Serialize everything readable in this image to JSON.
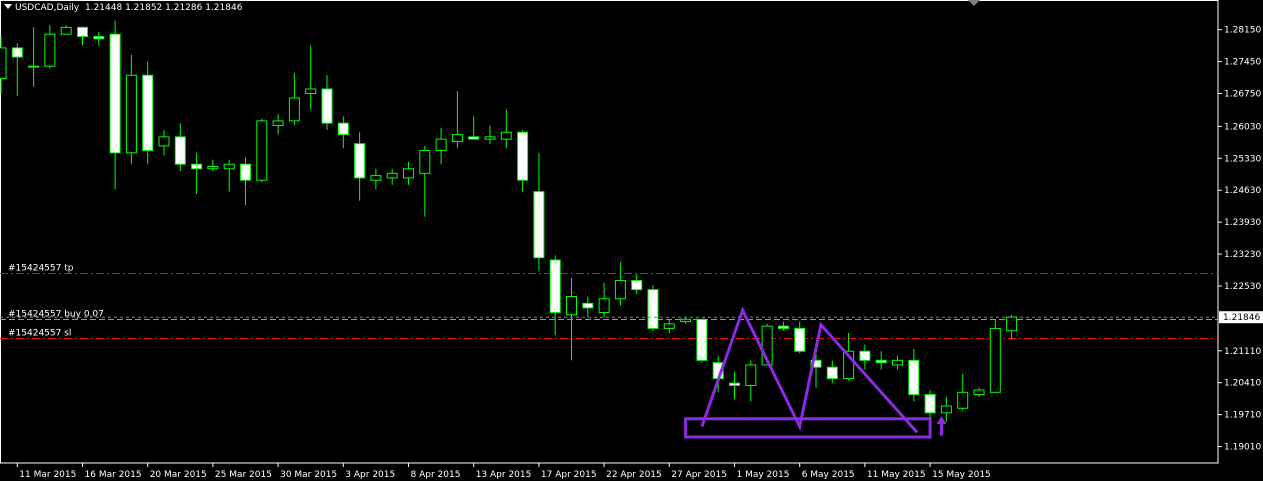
{
  "header": {
    "symbol": "USDCAD,Daily",
    "ohlc": "1.21448 1.21852 1.21286 1.21846"
  },
  "colors": {
    "background": "#000000",
    "frame": "#ffffff",
    "bull_body": "#000000",
    "bear_body": "#ffffff",
    "wick": "#00ff00",
    "order_line_sl_tp": "#ff0000",
    "order_line_buy": "#00ff00",
    "pattern_line": "#8a2be2"
  },
  "chart_data": {
    "type": "candlestick",
    "ylim": [
      1.1865,
      1.288
    ],
    "y_ticks": [
      "1.28150",
      "1.27450",
      "1.26750",
      "1.26030",
      "1.25330",
      "1.24630",
      "1.23930",
      "1.23230",
      "1.22530",
      "1.21110",
      "1.20410",
      "1.19710",
      "1.19010"
    ],
    "x_labels": [
      {
        "label": "11 Mar 2015",
        "bar": 1
      },
      {
        "label": "16 Mar 2015",
        "bar": 5
      },
      {
        "label": "20 Mar 2015",
        "bar": 9
      },
      {
        "label": "25 Mar 2015",
        "bar": 13
      },
      {
        "label": "30 Mar 2015",
        "bar": 17
      },
      {
        "label": "3 Apr 2015",
        "bar": 21
      },
      {
        "label": "8 Apr 2015",
        "bar": 25
      },
      {
        "label": "13 Apr 2015",
        "bar": 29
      },
      {
        "label": "17 Apr 2015",
        "bar": 33
      },
      {
        "label": "22 Apr 2015",
        "bar": 37
      },
      {
        "label": "27 Apr 2015",
        "bar": 41
      },
      {
        "label": "1 May 2015",
        "bar": 45
      },
      {
        "label": "6 May 2015",
        "bar": 49
      },
      {
        "label": "11 May 2015",
        "bar": 53
      },
      {
        "label": "15 May 2015",
        "bar": 57
      }
    ],
    "candles": [
      {
        "o": 1.2708,
        "h": 1.28,
        "l": 1.2675,
        "c": 1.2775
      },
      {
        "o": 1.2775,
        "h": 1.2785,
        "l": 1.267,
        "c": 1.2755
      },
      {
        "o": 1.2735,
        "h": 1.282,
        "l": 1.269,
        "c": 1.2735
      },
      {
        "o": 1.2735,
        "h": 1.2825,
        "l": 1.273,
        "c": 1.2805
      },
      {
        "o": 1.2805,
        "h": 1.2825,
        "l": 1.2805,
        "c": 1.282
      },
      {
        "o": 1.282,
        "h": 1.2822,
        "l": 1.278,
        "c": 1.28
      },
      {
        "o": 1.28,
        "h": 1.281,
        "l": 1.278,
        "c": 1.2795
      },
      {
        "o": 1.2805,
        "h": 1.2835,
        "l": 1.2465,
        "c": 1.2545
      },
      {
        "o": 1.2545,
        "h": 1.276,
        "l": 1.252,
        "c": 1.2715
      },
      {
        "o": 1.2715,
        "h": 1.2745,
        "l": 1.252,
        "c": 1.255
      },
      {
        "o": 1.256,
        "h": 1.2595,
        "l": 1.254,
        "c": 1.258
      },
      {
        "o": 1.258,
        "h": 1.261,
        "l": 1.2505,
        "c": 1.252
      },
      {
        "o": 1.252,
        "h": 1.2545,
        "l": 1.2455,
        "c": 1.251
      },
      {
        "o": 1.251,
        "h": 1.253,
        "l": 1.2505,
        "c": 1.2515
      },
      {
        "o": 1.251,
        "h": 1.253,
        "l": 1.246,
        "c": 1.252
      },
      {
        "o": 1.252,
        "h": 1.2535,
        "l": 1.243,
        "c": 1.2485
      },
      {
        "o": 1.2485,
        "h": 1.262,
        "l": 1.248,
        "c": 1.2615
      },
      {
        "o": 1.2605,
        "h": 1.263,
        "l": 1.2585,
        "c": 1.2615
      },
      {
        "o": 1.2615,
        "h": 1.272,
        "l": 1.2605,
        "c": 1.2665
      },
      {
        "o": 1.2675,
        "h": 1.278,
        "l": 1.264,
        "c": 1.2685
      },
      {
        "o": 1.2685,
        "h": 1.2715,
        "l": 1.2595,
        "c": 1.261
      },
      {
        "o": 1.261,
        "h": 1.2625,
        "l": 1.2555,
        "c": 1.2585
      },
      {
        "o": 1.2565,
        "h": 1.259,
        "l": 1.244,
        "c": 1.249
      },
      {
        "o": 1.2485,
        "h": 1.251,
        "l": 1.2465,
        "c": 1.2495
      },
      {
        "o": 1.249,
        "h": 1.251,
        "l": 1.2475,
        "c": 1.25
      },
      {
        "o": 1.249,
        "h": 1.2525,
        "l": 1.2475,
        "c": 1.251
      },
      {
        "o": 1.25,
        "h": 1.256,
        "l": 1.2405,
        "c": 1.255
      },
      {
        "o": 1.255,
        "h": 1.26,
        "l": 1.252,
        "c": 1.2575
      },
      {
        "o": 1.257,
        "h": 1.268,
        "l": 1.2555,
        "c": 1.2585
      },
      {
        "o": 1.258,
        "h": 1.2625,
        "l": 1.2575,
        "c": 1.2575
      },
      {
        "o": 1.2575,
        "h": 1.2605,
        "l": 1.2565,
        "c": 1.258
      },
      {
        "o": 1.2575,
        "h": 1.264,
        "l": 1.2555,
        "c": 1.259
      },
      {
        "o": 1.259,
        "h": 1.2595,
        "l": 1.246,
        "c": 1.2485
      },
      {
        "o": 1.246,
        "h": 1.2545,
        "l": 1.2285,
        "c": 1.2315
      },
      {
        "o": 1.231,
        "h": 1.232,
        "l": 1.2145,
        "c": 1.2195
      },
      {
        "o": 1.219,
        "h": 1.227,
        "l": 1.209,
        "c": 1.223
      },
      {
        "o": 1.2215,
        "h": 1.223,
        "l": 1.2185,
        "c": 1.2205
      },
      {
        "o": 1.2195,
        "h": 1.226,
        "l": 1.2185,
        "c": 1.2225
      },
      {
        "o": 1.2225,
        "h": 1.2305,
        "l": 1.221,
        "c": 1.2265
      },
      {
        "o": 1.2265,
        "h": 1.228,
        "l": 1.2235,
        "c": 1.2245
      },
      {
        "o": 1.2245,
        "h": 1.2255,
        "l": 1.2155,
        "c": 1.216
      },
      {
        "o": 1.216,
        "h": 1.218,
        "l": 1.215,
        "c": 1.217
      },
      {
        "o": 1.2175,
        "h": 1.2185,
        "l": 1.217,
        "c": 1.218
      },
      {
        "o": 1.218,
        "h": 1.218,
        "l": 1.2085,
        "c": 1.209
      },
      {
        "o": 1.2085,
        "h": 1.21,
        "l": 1.202,
        "c": 1.205
      },
      {
        "o": 1.204,
        "h": 1.2065,
        "l": 1.2005,
        "c": 1.2035
      },
      {
        "o": 1.2035,
        "h": 1.209,
        "l": 1.2,
        "c": 1.208
      },
      {
        "o": 1.208,
        "h": 1.217,
        "l": 1.208,
        "c": 1.2165
      },
      {
        "o": 1.2165,
        "h": 1.2175,
        "l": 1.2155,
        "c": 1.216
      },
      {
        "o": 1.216,
        "h": 1.2175,
        "l": 1.2105,
        "c": 1.211
      },
      {
        "o": 1.209,
        "h": 1.2105,
        "l": 1.203,
        "c": 1.2075
      },
      {
        "o": 1.2075,
        "h": 1.209,
        "l": 1.204,
        "c": 1.205
      },
      {
        "o": 1.205,
        "h": 1.215,
        "l": 1.2045,
        "c": 1.211
      },
      {
        "o": 1.211,
        "h": 1.2125,
        "l": 1.207,
        "c": 1.209
      },
      {
        "o": 1.209,
        "h": 1.211,
        "l": 1.207,
        "c": 1.2085
      },
      {
        "o": 1.208,
        "h": 1.21,
        "l": 1.207,
        "c": 1.209
      },
      {
        "o": 1.209,
        "h": 1.2115,
        "l": 1.2,
        "c": 1.2015
      },
      {
        "o": 1.2015,
        "h": 1.2025,
        "l": 1.1945,
        "c": 1.1975
      },
      {
        "o": 1.1975,
        "h": 1.201,
        "l": 1.1955,
        "c": 1.199
      },
      {
        "o": 1.1985,
        "h": 1.206,
        "l": 1.198,
        "c": 1.202
      },
      {
        "o": 1.2015,
        "h": 1.203,
        "l": 1.201,
        "c": 1.2025
      },
      {
        "o": 1.202,
        "h": 1.218,
        "l": 1.202,
        "c": 1.216
      },
      {
        "o": 1.2155,
        "h": 1.219,
        "l": 1.2135,
        "c": 1.2185
      }
    ],
    "current_price": "1.21846",
    "order_lines": [
      {
        "label": "#15424557 tp",
        "price": 1.2282,
        "style": "tp"
      },
      {
        "label": "#15424557 buy 0.07",
        "price": 1.218,
        "style": "buy"
      },
      {
        "label": "#15424557 sl",
        "price": 1.214,
        "style": "sl"
      }
    ],
    "annotations": {
      "pattern_points": [
        [
          43,
          1.1945
        ],
        [
          45.5,
          1.22
        ],
        [
          49,
          1.1945
        ],
        [
          50.3,
          1.2168
        ],
        [
          56.2,
          1.1932
        ]
      ],
      "support_box": {
        "bar_from": 42,
        "bar_to": 57,
        "price_top": 1.1962,
        "price_bottom": 1.1922
      },
      "arrow": {
        "bar": 57.7,
        "price_from": 1.1925,
        "price_to": 1.1968
      }
    }
  }
}
